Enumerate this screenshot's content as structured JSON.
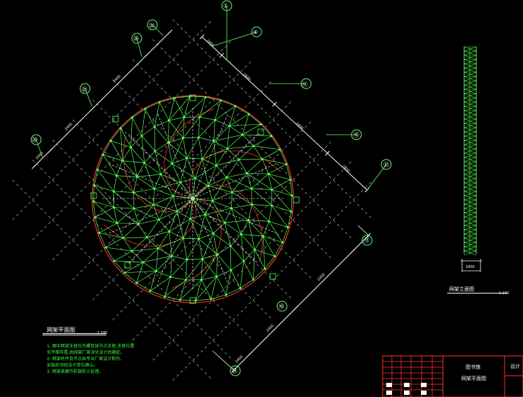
{
  "colors": {
    "background": "#000000",
    "dome_outline": "#ff3030",
    "dome_members": "#55ff55",
    "dome_chords": "#ffffff",
    "axis_lines": "#66ff66",
    "dim_lines": "#ffffff",
    "dashed_grid": "#cccccc",
    "title_block": "#ff3030",
    "text": "#ffffff"
  },
  "plan": {
    "title": "网架平面图",
    "scale": "1:100",
    "notes": [
      "1. 图中网架支座均为螺栓球节点支座,支座位置",
      "   见平面布置,由网架厂家深化设计后确定。",
      "2. 网架杆件及节点由专业厂家设计制作,",
      "   安装前须经设计单位确认。",
      "3. 网架表面作防腐防火处理。"
    ]
  },
  "axes_top": [
    "①",
    "⑥",
    "⑪",
    "⑯",
    "㉑"
  ],
  "axes_left": [
    "㉕",
    "㉖",
    "㉗",
    "㉘"
  ],
  "axes_bottom": [
    "⑪",
    "⑯",
    "㉑"
  ],
  "dims_top": [
    "2400",
    "2400",
    "2400",
    "2400"
  ],
  "dims_left": [
    "2400",
    "2400",
    "2400"
  ],
  "dims_bottom": [
    "2400",
    "2400",
    "2400"
  ],
  "elevation": {
    "title": "网架立面图",
    "scale": "1:100",
    "dim": "1800"
  },
  "title_block": {
    "drawing_name": "网架平面图",
    "project": "图书馆",
    "stage": "设计"
  }
}
